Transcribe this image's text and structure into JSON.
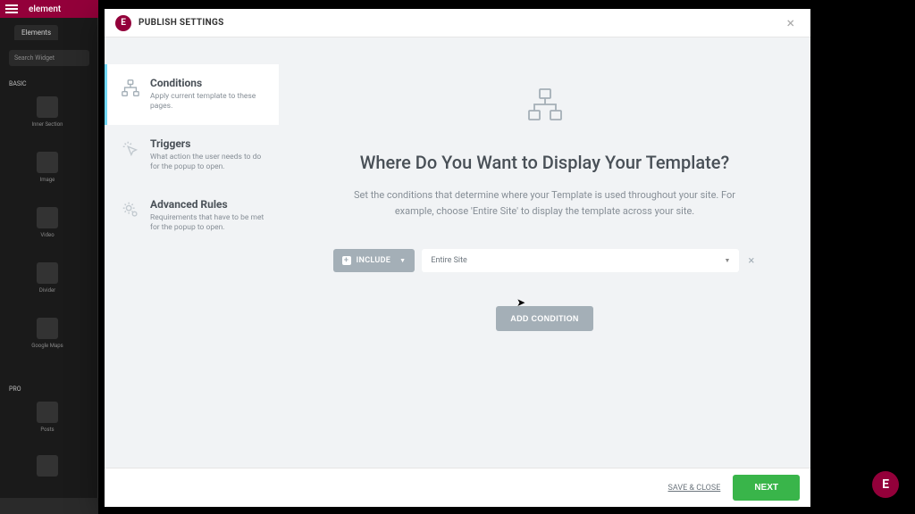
{
  "bg": {
    "brand": "element",
    "tab": "Elements",
    "search": "Search Widget",
    "section_basic": "BASIC",
    "widgets_basic": [
      "Inner Section",
      "Image",
      "Video",
      "Divider",
      "Google Maps"
    ],
    "section_pro": "PRO",
    "widgets_pro": [
      "Posts"
    ]
  },
  "modal": {
    "title": "PUBLISH SETTINGS",
    "sidebar": [
      {
        "title": "Conditions",
        "desc": "Apply current template to these pages."
      },
      {
        "title": "Triggers",
        "desc": "What action the user needs to do for the popup to open."
      },
      {
        "title": "Advanced Rules",
        "desc": "Requirements that have to be met for the popup to open."
      }
    ],
    "main_title": "Where Do You Want to Display Your Template?",
    "main_desc": "Set the conditions that determine where your Template is used throughout your site. For example, choose 'Entire Site' to display the template across your site.",
    "include_label": "INCLUDE",
    "scope_value": "Entire Site",
    "add_condition": "ADD CONDITION",
    "save_close": "SAVE & CLOSE",
    "next": "NEXT"
  }
}
